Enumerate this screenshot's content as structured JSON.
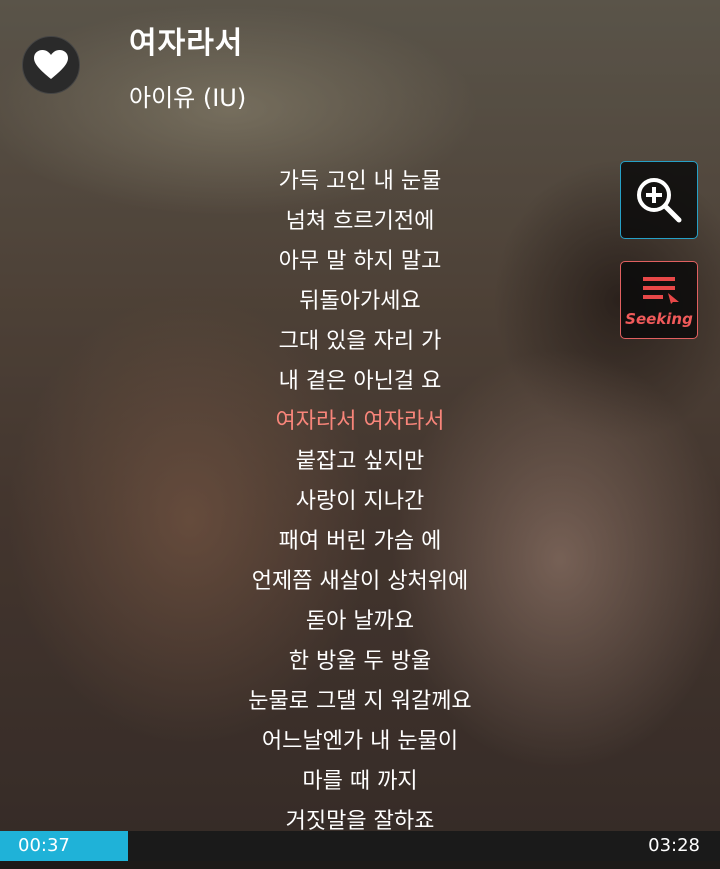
{
  "song": {
    "title": "여자라서",
    "artist": "아이유 (IU)"
  },
  "controls": {
    "favorite_icon": "heart-icon",
    "zoom_icon": "zoom-in-icon",
    "seek_icon": "seeking-icon",
    "seek_label": "Seeking"
  },
  "lyrics": [
    "가득 고인 내 눈물",
    "넘쳐 흐르기전에",
    "아무 말 하지 말고",
    "뒤돌아가세요",
    "그대 있을 자리 가",
    "내 곁은 아닌걸 요",
    "여자라서 여자라서",
    "붙잡고 싶지만",
    "사랑이 지나간",
    "패여 버린 가슴 에",
    "언제쯤 새살이 상처위에",
    "돋아 날까요",
    "한 방울 두 방울",
    "눈물로 그댈 지 워갈께요",
    "어느날엔가 내 눈물이",
    "마를 때 까지",
    "거짓말을 잘하죠"
  ],
  "current_lyric_index": 6,
  "playback": {
    "elapsed": "00:37",
    "total": "03:28",
    "progress": 0.178
  },
  "colors": {
    "accent": "#1fb2d8",
    "current_lyric": "#f8857a",
    "seek_accent": "#e06060",
    "zoom_border": "#26a0c6"
  }
}
